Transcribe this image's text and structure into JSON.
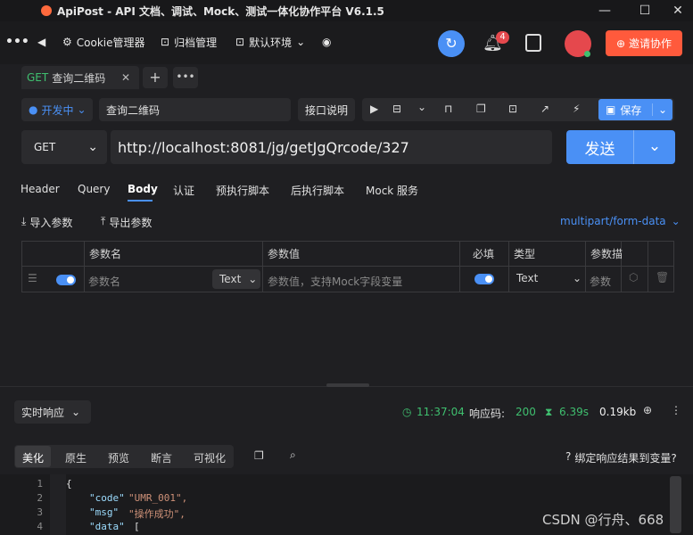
{
  "window": {
    "title": "ApiPost - API 文档、调试、Mock、测试一体化协作平台 V6.1.5"
  },
  "toolbar": {
    "cookie_label": "Cookie管理器",
    "archive_label": "归档管理",
    "env_label": "默认环境",
    "notif_count": "4",
    "invite_label": "邀请协作"
  },
  "tab": {
    "method": "GET",
    "name": "查询二维码"
  },
  "request": {
    "status": "开发中",
    "name": "查询二维码",
    "doc_label": "接口说明",
    "save_label": "保存",
    "method": "GET",
    "url": "http://localhost:8081/jg/getJgQrcode/327",
    "send_label": "发送"
  },
  "param_tabs": [
    "Header",
    "Query",
    "Body",
    "认证",
    "预执行脚本",
    "后执行脚本",
    "Mock 服务"
  ],
  "body": {
    "import_label": "导入参数",
    "export_label": "导出参数",
    "content_type": "multipart/form-data",
    "columns": {
      "name": "参数名",
      "value": "参数值",
      "required": "必填",
      "type": "类型",
      "desc": "参数描"
    },
    "row": {
      "name_placeholder": "参数名",
      "field_type": "Text",
      "value_placeholder": "参数值，支持Mock字段变量",
      "type": "Text",
      "desc_placeholder": "参数"
    }
  },
  "response": {
    "mode_label": "实时响应",
    "time": "11:37:04",
    "code_label": "响应码:",
    "code": "200",
    "duration": "6.39s",
    "size": "0.19kb",
    "view_tabs": [
      "美化",
      "原生",
      "预览",
      "断言",
      "可视化"
    ],
    "bind_label": "绑定响应结果到变量?",
    "lines": [
      {
        "n": "1",
        "text": "{"
      },
      {
        "n": "2",
        "key": "\"code\"",
        "val": "\"UMR_001\","
      },
      {
        "n": "3",
        "key": "\"msg\"",
        "val": "\"操作成功\","
      },
      {
        "n": "4",
        "key": "\"data\"",
        "val": "["
      }
    ]
  },
  "watermark": "CSDN @行舟、668",
  "colors": {
    "accent": "#4a90f5",
    "invite": "#ff5a3c",
    "success": "#3fbf6f",
    "string": "#ce9178"
  }
}
